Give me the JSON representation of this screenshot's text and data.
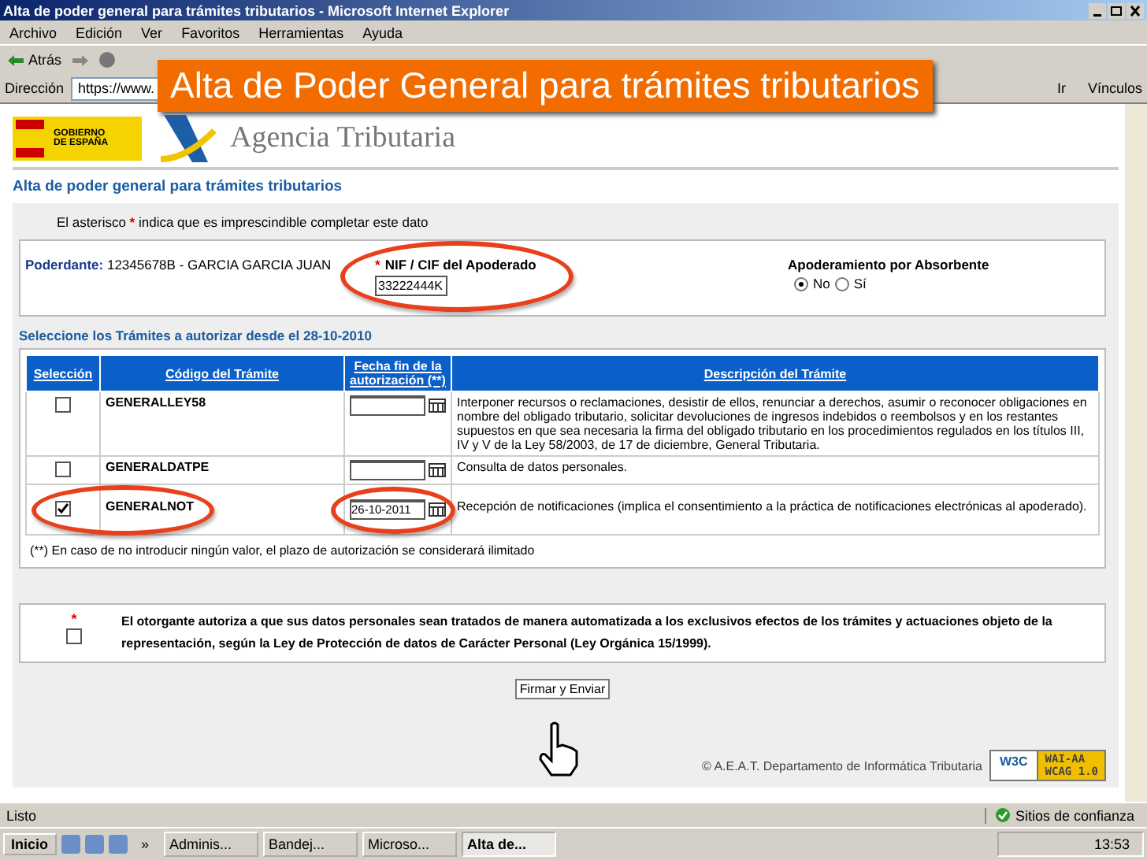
{
  "window": {
    "title": "Alta de poder general para trámites tributarios - Microsoft Internet Explorer"
  },
  "menu": [
    "Archivo",
    "Edición",
    "Ver",
    "Favoritos",
    "Herramientas",
    "Ayuda"
  ],
  "toolbar": {
    "back": "Atrás"
  },
  "address": {
    "label": "Dirección",
    "value": "https://www.",
    "go": "Ir",
    "links": "Vínculos"
  },
  "banner": "Alta de Poder General para trámites tributarios",
  "header": {
    "gov": "GOBIERNO DE ESPAÑA",
    "agency": "Agencia Tributaria"
  },
  "page_title": "Alta de poder general para trámites tributarios",
  "note": "El asterisco * indica que es imprescindible completar este dato",
  "poderdante": {
    "label": "Poderdante:",
    "value": "12345678B - GARCIA GARCIA JUAN"
  },
  "nif": {
    "required_mark": "*",
    "label": "NIF / CIF del Apoderado",
    "value": "33222444K",
    "highlighted": true
  },
  "absorbente": {
    "label": "Apoderamiento por Absorbente",
    "options": [
      {
        "label": "No",
        "selected": true
      },
      {
        "label": "Sí",
        "selected": false
      }
    ]
  },
  "section_title": "Seleccione los Trámites a autorizar desde el 28-10-2010",
  "table": {
    "columns": [
      "Selección",
      "Código del Trámite",
      "Fecha fin de la autorización (**)",
      "Descripción del Trámite"
    ],
    "rows": [
      {
        "checked": false,
        "highlighted": false,
        "code": "GENERALLEY58",
        "date": "",
        "description": "Interponer recursos o reclamaciones, desistir de ellos, renunciar a derechos, asumir o reconocer obligaciones en nombre del obligado tributario, solicitar devoluciones de ingresos indebidos o reembolsos y en los restantes supuestos en que sea necesaria la firma del obligado tributario en los procedimientos regulados en los títulos III, IV y V de la Ley 58/2003, de 17 de diciembre, General Tributaria."
      },
      {
        "checked": false,
        "highlighted": false,
        "code": "GENERALDATPE",
        "date": "",
        "description": "Consulta de datos personales."
      },
      {
        "checked": true,
        "highlighted": true,
        "code": "GENERALNOT",
        "date": "26-10-2011",
        "description": "Recepción de notificaciones (implica el consentimiento a la práctica de notificaciones electrónicas al apoderado)."
      }
    ]
  },
  "footnote": "(**) En caso de no introducir ningún valor, el plazo de autorización se considerará ilimitado",
  "consent": {
    "required_mark": "*",
    "checked": false,
    "text": "El otorgante autoriza a que sus datos personales sean tratados de manera automatizada a los exclusivos efectos de los trámites y actuaciones objeto de la representación, según la Ley de Protección de datos de Carácter Personal (Ley Orgánica 15/1999)."
  },
  "submit": "Firmar y Enviar",
  "copyright": "© A.E.A.T. Departamento de Informática Tributaria",
  "wcag": {
    "logo": "W3C",
    "top": "WAI-AA",
    "bottom": "WCAG 1.0"
  },
  "status_bar": {
    "text": "Listo",
    "zone": "Sitios de confianza"
  },
  "taskbar": {
    "start": "Inicio",
    "more": "»",
    "tasks": [
      {
        "label": "Adminis...",
        "selected": false
      },
      {
        "label": "Bandej...",
        "selected": false
      },
      {
        "label": "Microso...",
        "selected": false
      },
      {
        "label": "Alta de...",
        "selected": true
      }
    ],
    "clock": "13:53"
  }
}
